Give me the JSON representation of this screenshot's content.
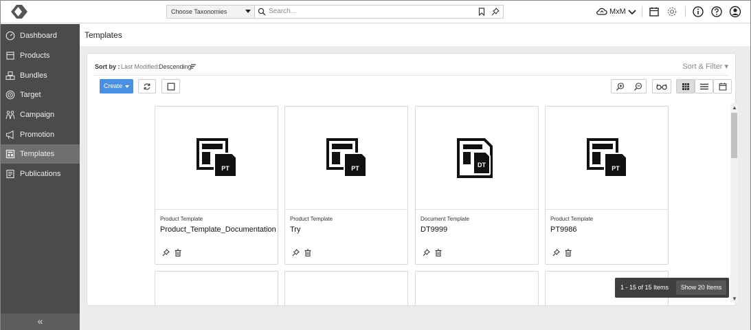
{
  "topbar": {
    "taxonomy_placeholder": "Choose Taxonomies",
    "search_placeholder": "Search...",
    "user_label": "MxM"
  },
  "sidebar": {
    "items": [
      {
        "label": "Dashboard",
        "icon": "dashboard-icon"
      },
      {
        "label": "Products",
        "icon": "products-icon"
      },
      {
        "label": "Bundles",
        "icon": "bundles-icon"
      },
      {
        "label": "Target",
        "icon": "target-icon"
      },
      {
        "label": "Campaign",
        "icon": "campaign-icon"
      },
      {
        "label": "Promotion",
        "icon": "promotion-icon"
      },
      {
        "label": "Templates",
        "icon": "templates-icon",
        "active": true
      },
      {
        "label": "Publications",
        "icon": "publications-icon"
      }
    ],
    "collapse_glyph": "«"
  },
  "page": {
    "title": "Templates"
  },
  "sortbar": {
    "label": "Sort by :",
    "field": "Last Modified:",
    "direction": "Descending",
    "sort_filter": "Sort & Filter ▾"
  },
  "toolbar": {
    "create_label": "Create"
  },
  "cards": [
    {
      "type": "Product Template",
      "name": "Product_Template_Documentation",
      "badge": "PT"
    },
    {
      "type": "Product Template",
      "name": "Try",
      "badge": "PT"
    },
    {
      "type": "Document Template",
      "name": "DT9999",
      "badge": "DT"
    },
    {
      "type": "Product Template",
      "name": "PT9986",
      "badge": "PT"
    }
  ],
  "pager": {
    "count": "1 - 15 of 15 Items",
    "show_label": "Show 20 Items"
  },
  "colors": {
    "sidebar": "#4b4b4b",
    "sidebar_active": "#6f6f6f",
    "accent": "#4a90e2",
    "pager": "#3f3f3f"
  }
}
